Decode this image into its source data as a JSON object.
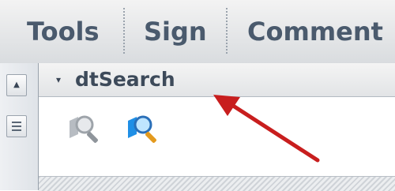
{
  "tabs": [
    {
      "label": "Tools"
    },
    {
      "label": "Sign"
    },
    {
      "label": "Comment"
    }
  ],
  "panel": {
    "title": "dtSearch",
    "collapse_glyph": "▾"
  },
  "rail": {
    "up_glyph": "▲"
  },
  "icons": {
    "search_disabled": "search-disabled-icon",
    "search_active": "search-icon",
    "annotation_arrow": "red-arrow"
  },
  "colors": {
    "tab_text": "#4a5a6d",
    "arrow": "#c81e1e",
    "accent_blue": "#1f8fe6"
  }
}
